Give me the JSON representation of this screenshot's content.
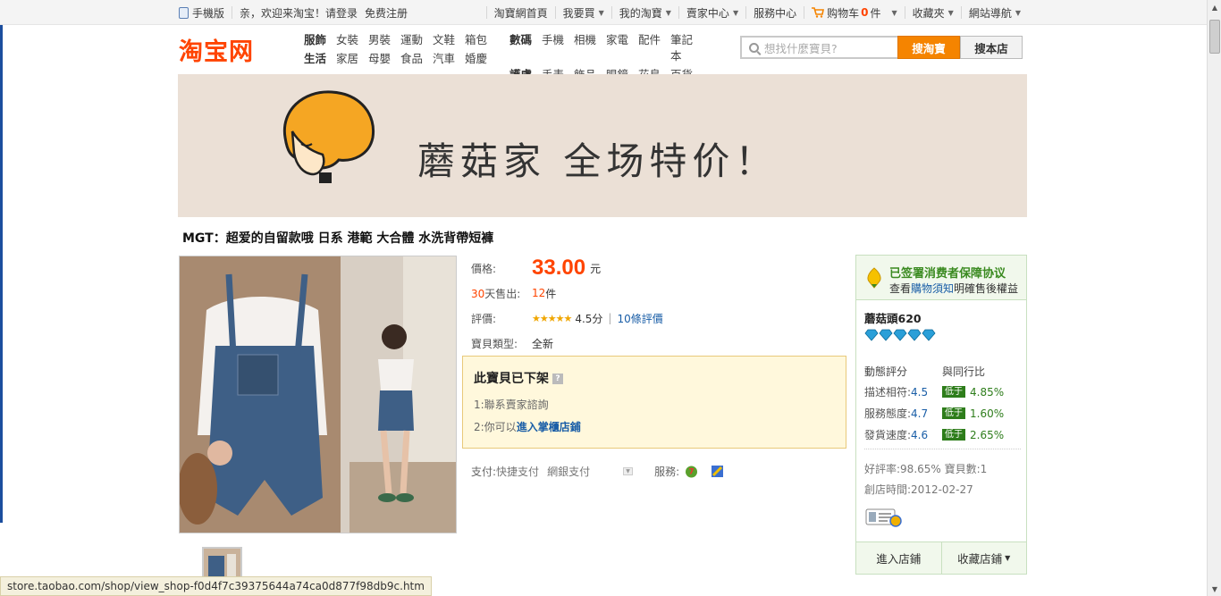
{
  "topbar": {
    "mobile": "手機版",
    "welcome": "亲，欢迎来淘宝！请",
    "login": "登录",
    "register": "免费注册",
    "links": [
      "淘寶網首頁",
      "我要買",
      "我的淘寶",
      "賣家中心",
      "服務中心",
      "购物车",
      "收藏夾",
      "網站導航"
    ],
    "cart_count": "0",
    "cart_unit": "件"
  },
  "header": {
    "logo": "淘宝网",
    "cats_a": [
      [
        "服飾",
        "女裝",
        "男裝",
        "運動",
        "文鞋",
        "箱包"
      ],
      [
        "生活",
        "家居",
        "母嬰",
        "食品",
        "汽車",
        "婚慶"
      ]
    ],
    "cats_b": [
      [
        "數碼",
        "手機",
        "相機",
        "家電",
        "配件",
        "筆記本"
      ],
      [
        "護膚",
        "手表",
        "飾品",
        "眼鏡",
        "花鳥",
        "百貨"
      ]
    ],
    "search_placeholder": "想找什麼寶貝?",
    "search_btn": "搜淘寶",
    "store_btn": "搜本店"
  },
  "banner": {
    "text": "蘑菇家  全场特价！"
  },
  "product": {
    "title": "MGT：超爱的自留款哦 日系 港範 大合體 水洗背帶短褲",
    "price_label": "價格:",
    "price": "33.00",
    "currency": "元",
    "sold_label_num": "30",
    "sold_label": "天售出:",
    "sold": "12",
    "sold_unit": "件",
    "rating_label": "評價:",
    "stars": "★★★★★",
    "score": "4.5分",
    "reviews": "10條評價",
    "type_label": "寶貝類型:",
    "type": "全新",
    "off_title": "此寶貝已下架",
    "off_1": "1:聯系賣家諮詢",
    "off_2_prefix": "2:你可以",
    "off_2_link": "進入掌櫃店鋪",
    "pay_label": "支付:",
    "pay_1": "快捷支付",
    "pay_2": "網銀支付",
    "service_label": "服務:"
  },
  "seller": {
    "agreement": "已签署消费者保障协议",
    "view": "查看",
    "notice_link": "購物須知",
    "rights": "明確售後權益",
    "name": "蘑菇頭620",
    "dyn_head": "動態評分",
    "peer_head": "與同行比",
    "scores": [
      {
        "k": "描述相符:",
        "v": "4.5",
        "tag": "低于",
        "pct": "4.85%"
      },
      {
        "k": "服務態度:",
        "v": "4.7",
        "tag": "低于",
        "pct": "1.60%"
      },
      {
        "k": "發貨速度:",
        "v": "4.6",
        "tag": "低于",
        "pct": "2.65%"
      }
    ],
    "good_rate": "好評率:98.65%",
    "items": "寶貝數:1",
    "since": "創店時間:2012-02-27",
    "enter": "進入店鋪",
    "fav": "收藏店鋪"
  },
  "status_url": "store.taobao.com/shop/view_shop-f0d4f7c39375644a74ca0d877f98db9c.htm",
  "colors": {
    "accent": "#ff4400",
    "green": "#2e7d1b",
    "banner": "#ebe0d6"
  }
}
